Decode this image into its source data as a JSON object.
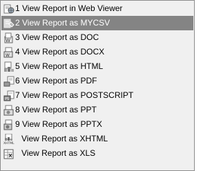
{
  "menu": {
    "items": [
      {
        "mnemonic": "1",
        "label": "1 View Report in Web Viewer",
        "icon": "web-viewer-report-icon",
        "highlighted": false
      },
      {
        "mnemonic": "2",
        "label": "2 View Report as MYCSV",
        "icon": "csv-report-icon",
        "highlighted": true
      },
      {
        "mnemonic": "3",
        "label": "3 View Report as DOC",
        "icon": "doc-report-icon",
        "highlighted": false
      },
      {
        "mnemonic": "4",
        "label": "4 View Report as DOCX",
        "icon": "docx-report-icon",
        "highlighted": false
      },
      {
        "mnemonic": "5",
        "label": "5 View Report as HTML",
        "icon": "html-report-icon",
        "highlighted": false
      },
      {
        "mnemonic": "6",
        "label": "6 View Report as PDF",
        "icon": "pdf-report-icon",
        "highlighted": false
      },
      {
        "mnemonic": "7",
        "label": "7 View Report as POSTSCRIPT",
        "icon": "postscript-report-icon",
        "highlighted": false
      },
      {
        "mnemonic": "8",
        "label": "8 View Report as PPT",
        "icon": "ppt-report-icon",
        "highlighted": false
      },
      {
        "mnemonic": "9",
        "label": "9 View Report as PPTX",
        "icon": "pptx-report-icon",
        "highlighted": false
      },
      {
        "mnemonic": "",
        "label": "View Report as XHTML",
        "icon": "xhtml-report-icon",
        "highlighted": false
      },
      {
        "mnemonic": "",
        "label": "View Report as XLS",
        "icon": "xls-report-icon",
        "highlighted": false
      }
    ]
  },
  "colors": {
    "menu_background": "#f0f0f0",
    "highlight_background": "#848484",
    "highlight_text": "#ffffff",
    "border": "#8c8c8c"
  }
}
